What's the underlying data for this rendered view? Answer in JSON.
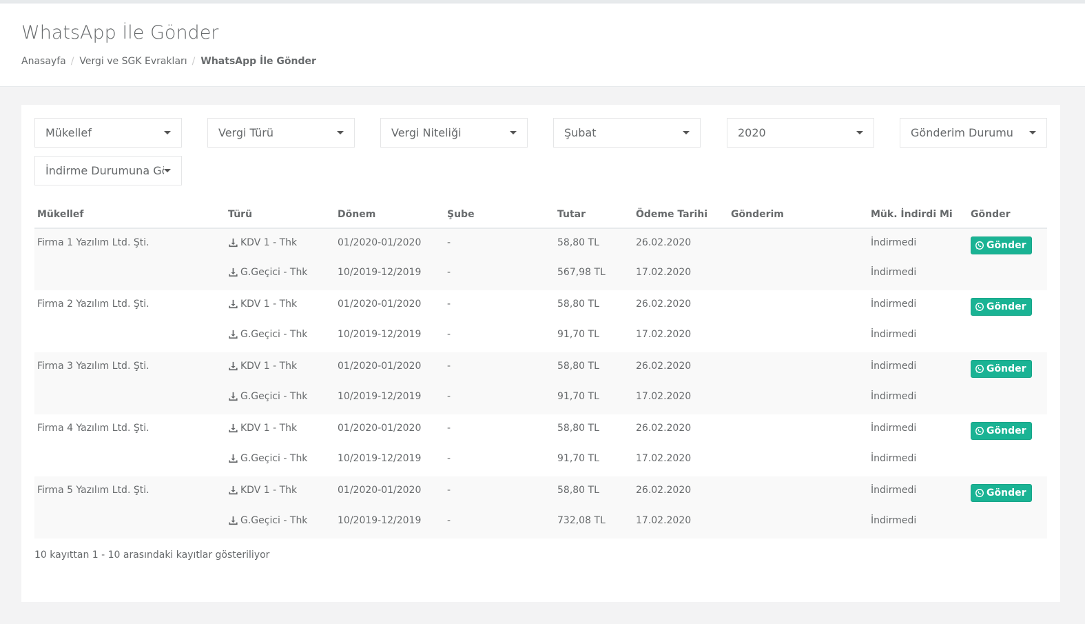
{
  "page": {
    "title": "WhatsApp İle Gönder",
    "breadcrumb": [
      {
        "label": "Anasayfa"
      },
      {
        "label": "Vergi ve SGK Evrakları"
      },
      {
        "label": "WhatsApp İle Gönder"
      }
    ]
  },
  "filters": {
    "mukellef": "Mükellef",
    "vergi_turu": "Vergi Türü",
    "vergi_niteligi": "Vergi Niteliği",
    "ay": "Şubat",
    "yil": "2020",
    "gonderim_durumu": "Gönderim Durumu",
    "indirme_durumu": "İndirme Durumuna Göre"
  },
  "table": {
    "headers": {
      "mukellef": "Mükellef",
      "turu": "Türü",
      "donem": "Dönem",
      "sube": "Şube",
      "tutar": "Tutar",
      "odeme_tarihi": "Ödeme Tarihi",
      "gonderim": "Gönderim",
      "indirdi_mi": "Mük. İndirdi Mi",
      "gonder": "Gönder"
    },
    "send_label": "Gönder",
    "groups": [
      {
        "mukellef": "Firma 1 Yazılım Ltd. Şti.",
        "rows": [
          {
            "turu": "KDV 1 - Thk",
            "donem": "01/2020-01/2020",
            "sube": "-",
            "tutar": "58,80 TL",
            "odeme_tarihi": "26.02.2020",
            "gonderim": "",
            "indirdi_mi": "İndirmedi"
          },
          {
            "turu": "G.Geçici - Thk",
            "donem": "10/2019-12/2019",
            "sube": "-",
            "tutar": "567,98 TL",
            "odeme_tarihi": "17.02.2020",
            "gonderim": "",
            "indirdi_mi": "İndirmedi"
          }
        ]
      },
      {
        "mukellef": "Firma 2 Yazılım Ltd. Şti.",
        "rows": [
          {
            "turu": "KDV 1 - Thk",
            "donem": "01/2020-01/2020",
            "sube": "-",
            "tutar": "58,80 TL",
            "odeme_tarihi": "26.02.2020",
            "gonderim": "",
            "indirdi_mi": "İndirmedi"
          },
          {
            "turu": "G.Geçici - Thk",
            "donem": "10/2019-12/2019",
            "sube": "-",
            "tutar": "91,70 TL",
            "odeme_tarihi": "17.02.2020",
            "gonderim": "",
            "indirdi_mi": "İndirmedi"
          }
        ]
      },
      {
        "mukellef": "Firma 3 Yazılım Ltd. Şti.",
        "rows": [
          {
            "turu": "KDV 1 - Thk",
            "donem": "01/2020-01/2020",
            "sube": "-",
            "tutar": "58,80 TL",
            "odeme_tarihi": "26.02.2020",
            "gonderim": "",
            "indirdi_mi": "İndirmedi"
          },
          {
            "turu": "G.Geçici - Thk",
            "donem": "10/2019-12/2019",
            "sube": "-",
            "tutar": "91,70 TL",
            "odeme_tarihi": "17.02.2020",
            "gonderim": "",
            "indirdi_mi": "İndirmedi"
          }
        ]
      },
      {
        "mukellef": "Firma 4 Yazılım Ltd. Şti.",
        "rows": [
          {
            "turu": "KDV 1 - Thk",
            "donem": "01/2020-01/2020",
            "sube": "-",
            "tutar": "58,80 TL",
            "odeme_tarihi": "26.02.2020",
            "gonderim": "",
            "indirdi_mi": "İndirmedi"
          },
          {
            "turu": "G.Geçici - Thk",
            "donem": "10/2019-12/2019",
            "sube": "-",
            "tutar": "91,70 TL",
            "odeme_tarihi": "17.02.2020",
            "gonderim": "",
            "indirdi_mi": "İndirmedi"
          }
        ]
      },
      {
        "mukellef": "Firma 5 Yazılım Ltd. Şti.",
        "rows": [
          {
            "turu": "KDV 1 - Thk",
            "donem": "01/2020-01/2020",
            "sube": "-",
            "tutar": "58,80 TL",
            "odeme_tarihi": "26.02.2020",
            "gonderim": "",
            "indirdi_mi": "İndirmedi"
          },
          {
            "turu": "G.Geçici - Thk",
            "donem": "10/2019-12/2019",
            "sube": "-",
            "tutar": "732,08 TL",
            "odeme_tarihi": "17.02.2020",
            "gonderim": "",
            "indirdi_mi": "İndirmedi"
          }
        ]
      }
    ]
  },
  "footer": {
    "info": "10 kayıttan 1 - 10 arasındaki kayıtlar gösteriliyor"
  },
  "colors": {
    "accent": "#1ab394",
    "text": "#676a6c",
    "background": "#f3f3f4"
  },
  "icons": {
    "download": "download-icon",
    "whatsapp": "whatsapp-icon",
    "dropdown": "caret-down-icon"
  }
}
